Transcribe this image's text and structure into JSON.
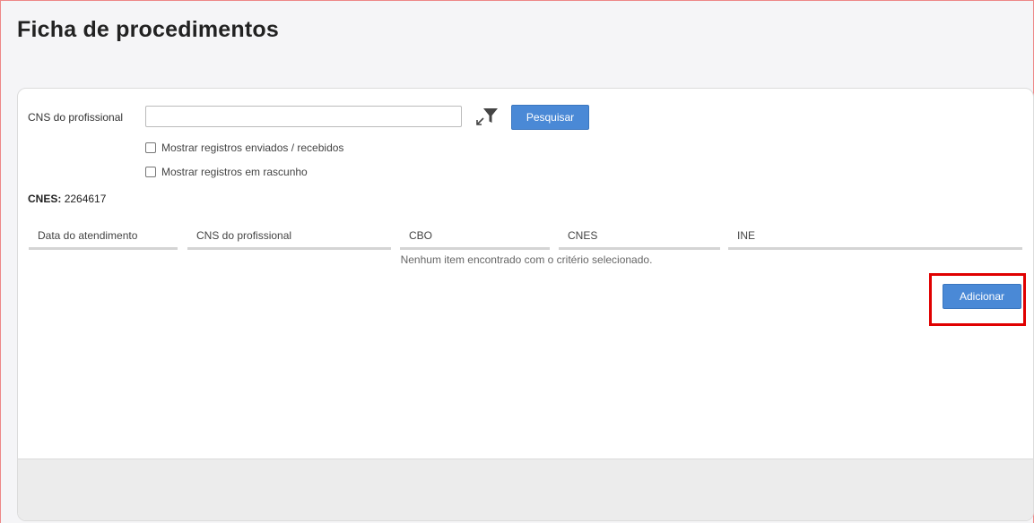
{
  "page": {
    "title": "Ficha de procedimentos"
  },
  "search": {
    "cns_label": "CNS do profissional",
    "cns_value": "",
    "cns_placeholder": "",
    "search_button": "Pesquisar",
    "filter_icon": "funnel-expand-icon"
  },
  "options": {
    "show_sent_received": "Mostrar registros enviados / recebidos",
    "show_sent_received_checked": false,
    "show_drafts": "Mostrar registros em rascunho",
    "show_drafts_checked": false
  },
  "cnes": {
    "label": "CNES:",
    "value": "2264617"
  },
  "table": {
    "columns": [
      "Data do atendimento",
      "CNS do profissional",
      "CBO",
      "CNES",
      "INE"
    ],
    "rows": [],
    "empty_message": "Nenhum item encontrado com o critério selecionado."
  },
  "actions": {
    "add_button": "Adicionar"
  },
  "colors": {
    "primary_button": "#4a89d6",
    "highlight": "#e00000"
  }
}
